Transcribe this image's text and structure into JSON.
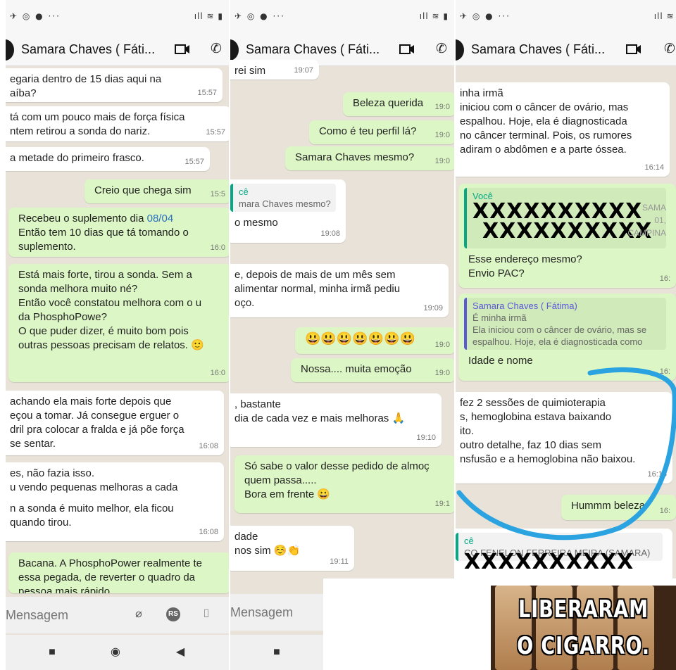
{
  "status": {
    "left": "✈ ◎ ● ···",
    "right": "ıll ≋ ▮"
  },
  "contact_name": "Samara Chaves ( Fáti...",
  "input_placeholder": "Mensagem",
  "panel1": {
    "messages": [
      {
        "text": [
          "egaria dentro de 15 dias aqui na",
          "aíba?"
        ],
        "time": "15:57",
        "dir": "in"
      },
      {
        "text": [
          "tá com um pouco mais de força física",
          "ntem retirou a sonda do nariz."
        ],
        "time": "15:57",
        "dir": "in"
      },
      {
        "text": [
          "a metade do primeiro frasco."
        ],
        "time": "15:57",
        "dir": "in"
      },
      {
        "text": [
          "Creio que chega sim"
        ],
        "time": "15:5",
        "dir": "out"
      },
      {
        "text_pre": "Recebeu o suplemento dia ",
        "link": "08/04",
        "text_post": [
          "Então tem 10 dias que tá tomando o",
          "suplemento."
        ],
        "time": "16:0",
        "dir": "out"
      },
      {
        "text": [
          "Está mais forte, tirou a sonda. Sem a",
          "sonda melhora muito né?",
          "Então você constatou melhora com o u",
          "da PhosphoPowe?",
          "O que puder dizer, é muito bom pois",
          "outras pessoas precisam de relatos. 🙂"
        ],
        "time": "16:0",
        "dir": "out"
      },
      {
        "text": [
          "achando ela mais forte depois que",
          "eçou a tomar. Já consegue erguer o",
          "dril pra colocar a fralda e já põe força",
          "se sentar."
        ],
        "time": "16:08",
        "dir": "in"
      },
      {
        "text": [
          "es, não fazia isso.",
          "u vendo pequenas melhoras a cada",
          "",
          "n a sonda é muito melhor, ela ficou",
          "quando tirou."
        ],
        "time": "16:08",
        "dir": "in"
      },
      {
        "text": [
          "Bacana. A PhosphoPower realmente te",
          "essa pegada, de reverter o quadro da",
          "pessoa mais rápido"
        ],
        "time": "",
        "dir": "out"
      }
    ]
  },
  "panel2": {
    "messages": [
      {
        "text": [
          "rei sim"
        ],
        "time": "19:07",
        "dir": "in"
      },
      {
        "text": [
          "Beleza querida"
        ],
        "time": "19:0",
        "dir": "out"
      },
      {
        "text": [
          "Como é teu perfil lá?"
        ],
        "time": "19:0",
        "dir": "out"
      },
      {
        "text": [
          "Samara Chaves mesmo?"
        ],
        "time": "19:0",
        "dir": "out"
      },
      {
        "quote_name": "cê",
        "quote_text": "mara Chaves mesmo?",
        "text": [
          "o mesmo"
        ],
        "time": "19:08",
        "dir": "in"
      },
      {
        "text": [
          "e, depois de mais de um mês sem",
          "alimentar normal, minha irmã pediu",
          "oço."
        ],
        "time": "19:09",
        "dir": "in"
      },
      {
        "text": [
          "😃😃😃😃😃😃😃"
        ],
        "time": "19:0",
        "dir": "out"
      },
      {
        "text": [
          "Nossa.... muita emoção"
        ],
        "time": "19:0",
        "dir": "out"
      },
      {
        "text": [
          ", bastante",
          " dia de cada vez e mais melhoras 🙏"
        ],
        "time": "19:10",
        "dir": "in"
      },
      {
        "text": [
          "Só sabe o valor desse pedido de almoç",
          "quem passa.....",
          "Bora em frente 😀"
        ],
        "time": "19:1",
        "dir": "out"
      },
      {
        "text": [
          "dade",
          "nos sim ☺️👏"
        ],
        "time": "19:11",
        "dir": "in"
      }
    ]
  },
  "panel3": {
    "messages": [
      {
        "text": [
          "inha irmã",
          "iniciou com o câncer de ovário, mas",
          "espalhou. Hoje, ela é diagnosticada",
          "no câncer terminal. Pois, os rumores",
          "adiram o abdômen e a parte óssea."
        ],
        "time": "16:14",
        "dir": "in"
      },
      {
        "quote_name": "Você",
        "redact1": "XXXXXXXXXX",
        "redact2": "XXXXXXXXXX",
        "under1": "SAMA",
        "under2": "01,",
        "under3": "CAMPINA",
        "text": [
          "Esse endereço mesmo?",
          "Envio PAC?"
        ],
        "time": "16:",
        "dir": "out"
      },
      {
        "quote_name": "Samara Chaves ( Fátima)",
        "quote_line1": "É minha irmã",
        "quote_line2": "Ela iniciou com o câncer de ovário, mas se",
        "quote_line3": "espalhou. Hoje, ela é diagnosticada como",
        "text": [
          "Idade e nome"
        ],
        "time": "16:",
        "dir": "out"
      },
      {
        "text": [
          "fez 2 sessões de quimioterapia",
          "s, hemoglobina estava baixando",
          "ito.",
          "outro detalhe, faz 10 dias sem",
          "nsfusão e a hemoglobina não baixou."
        ],
        "time": "16:15",
        "dir": "in"
      },
      {
        "text": [
          "Hummm beleza"
        ],
        "time": "16:",
        "dir": "out"
      },
      {
        "quote_name": "cê",
        "quote_text": "CO FENELON FERREIRA MEIRA (SAMARA)",
        "redact": "XXXXXXXXXX",
        "dir": "in"
      }
    ]
  },
  "meme": {
    "line1": "LIBERARAM",
    "line2": "O CIGARRO."
  },
  "annotation_color": "#2aa3e0"
}
